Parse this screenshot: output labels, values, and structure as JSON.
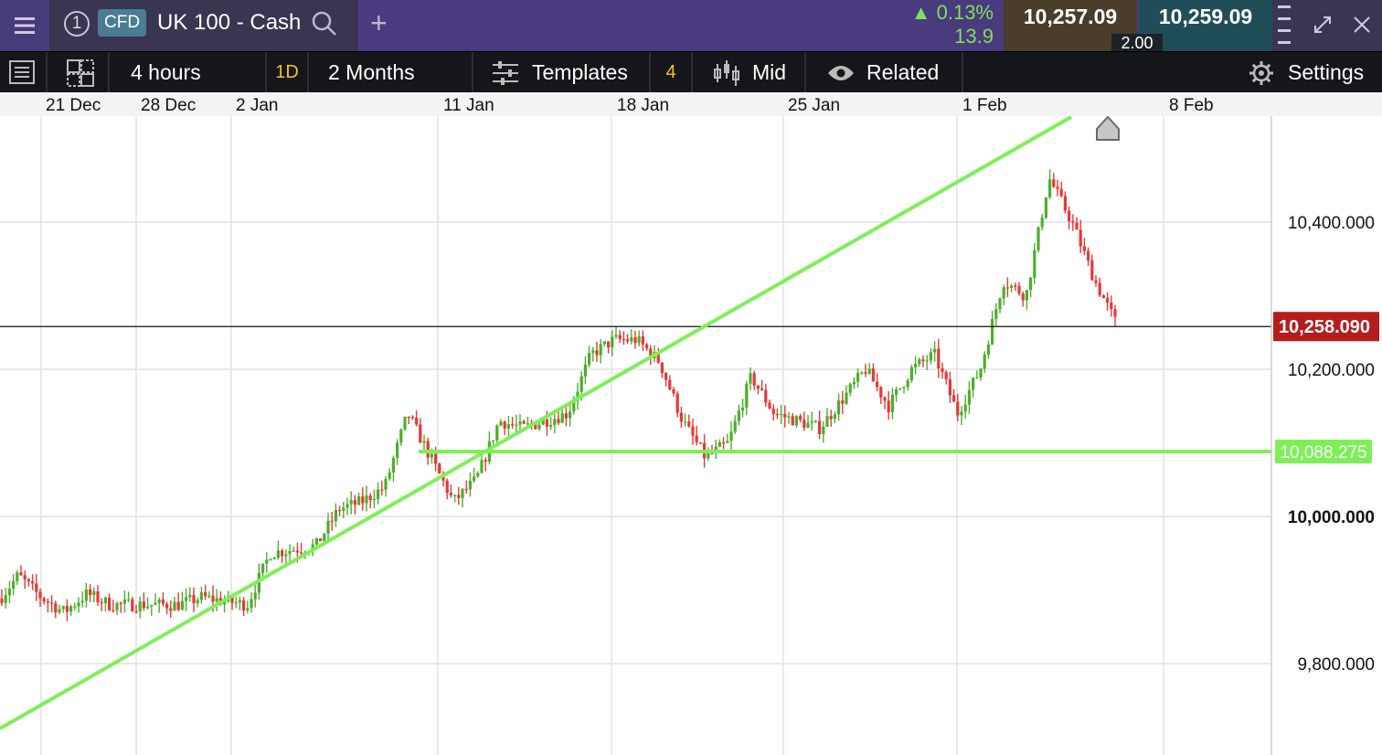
{
  "header": {
    "menu_icon": "hamburger-icon",
    "instrument_number": "1",
    "cfd_badge": "CFD",
    "instrument_name": "UK 100 - Cash",
    "search_icon": "search-icon",
    "add_icon": "plus-icon",
    "change_percent": "0.13%",
    "change_points": "13.9",
    "change_color": "#7ee05a",
    "sell_price": "10,257.09",
    "buy_price": "10,259.09",
    "spread": "2.00",
    "expand_icon": "expand-icon",
    "close_icon": "close-icon"
  },
  "toolbar": {
    "interval": "4 hours",
    "range_code": "1D",
    "range": "2 Months",
    "templates_label": "Templates",
    "templates_count": "4",
    "price_type": "Mid",
    "related_label": "Related",
    "settings_label": "Settings"
  },
  "chart_data": {
    "type": "candlestick",
    "x_tick_labels": [
      "21 Dec",
      "28 Dec",
      "2 Jan",
      "11 Jan",
      "18 Jan",
      "25 Jan",
      "1 Feb",
      "8 Feb"
    ],
    "y_tick_labels": [
      "10,400.000",
      "10,200.000",
      "10,000.000",
      "9,800.000"
    ],
    "ylim": [
      9730,
      10540
    ],
    "current_price": "10,258.090",
    "current_price_value": 10258.09,
    "support_level": "10,088.275",
    "support_value": 10088.275,
    "up_color": "#4caf2c",
    "down_color": "#e53935",
    "trendline_color": "#7df058",
    "current_price_color": "#b71c1c",
    "grid": true,
    "close_path": [
      [
        "2020-12-18",
        9830
      ],
      [
        "2020-12-19",
        9880
      ],
      [
        "2020-12-20",
        9920
      ],
      [
        "2020-12-21",
        9890
      ],
      [
        "2020-12-22",
        9870
      ],
      [
        "2020-12-23",
        9895
      ],
      [
        "2020-12-24",
        9880
      ],
      [
        "2020-12-27",
        9880
      ],
      [
        "2020-12-28",
        9890
      ],
      [
        "2020-12-29",
        9885
      ],
      [
        "2020-12-30",
        9880
      ],
      [
        "2020-12-31",
        9950
      ],
      [
        "2021-01-01",
        9955
      ],
      [
        "2021-01-02",
        9960
      ],
      [
        "2021-01-03",
        10010
      ],
      [
        "2021-01-04",
        10020
      ],
      [
        "2021-01-05",
        10040
      ],
      [
        "2021-01-06",
        10140
      ],
      [
        "2021-01-07",
        10080
      ],
      [
        "2021-01-08",
        10020
      ],
      [
        "2021-01-09",
        10050
      ],
      [
        "2021-01-10",
        10130
      ],
      [
        "2021-01-11",
        10120
      ],
      [
        "2021-01-12",
        10130
      ],
      [
        "2021-01-13",
        10140
      ],
      [
        "2021-01-14",
        10220
      ],
      [
        "2021-01-15",
        10240
      ],
      [
        "2021-01-16",
        10240
      ],
      [
        "2021-01-17",
        10210
      ],
      [
        "2021-01-18",
        10130
      ],
      [
        "2021-01-19",
        10080
      ],
      [
        "2021-01-20",
        10100
      ],
      [
        "2021-01-21",
        10190
      ],
      [
        "2021-01-22",
        10140
      ],
      [
        "2021-01-23",
        10130
      ],
      [
        "2021-01-24",
        10120
      ],
      [
        "2021-01-25",
        10160
      ],
      [
        "2021-01-26",
        10200
      ],
      [
        "2021-01-27",
        10150
      ],
      [
        "2021-01-28",
        10200
      ],
      [
        "2021-01-29",
        10220
      ],
      [
        "2021-01-30",
        10140
      ],
      [
        "2021-01-31",
        10200
      ],
      [
        "2021-02-01",
        10320
      ],
      [
        "2021-02-02",
        10300
      ],
      [
        "2021-02-03",
        10460
      ],
      [
        "2021-02-04",
        10400
      ],
      [
        "2021-02-05",
        10320
      ],
      [
        "2021-02-06",
        10258
      ]
    ]
  }
}
